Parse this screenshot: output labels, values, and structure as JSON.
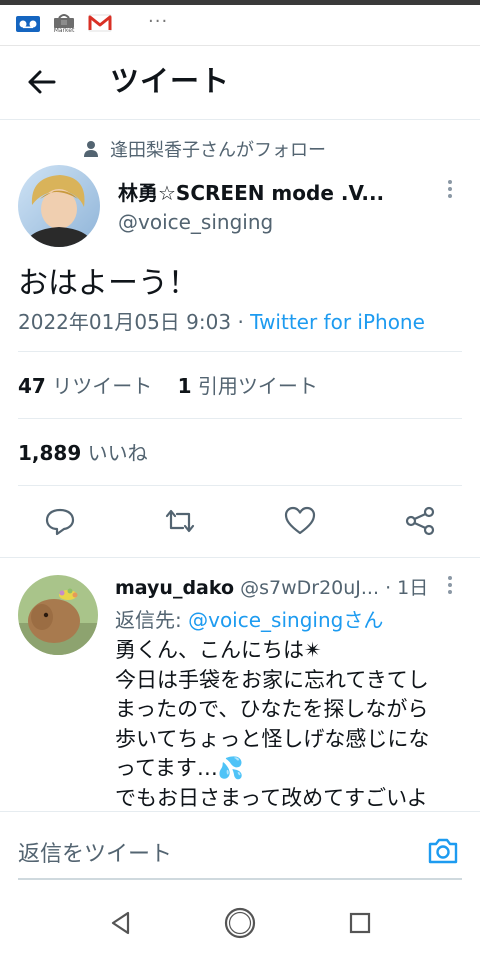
{
  "status_bar": {
    "icons": [
      "voicemail-icon",
      "market-app-icon",
      "gmail-icon"
    ],
    "market_label": "Market",
    "more_label": "···"
  },
  "header": {
    "title": "ツイート",
    "back_icon": "arrow-left-icon"
  },
  "tweet": {
    "social_context": "逢田梨香子さんがフォロー",
    "author_name": "林勇☆SCREEN mode .V...",
    "author_handle": "@voice_singing",
    "text": "おはよーう！",
    "timestamp": "2022年01月05日 9:03",
    "separator": "·",
    "source": "Twitter for iPhone",
    "retweets": {
      "count": "47",
      "label": "リツイート"
    },
    "quotes": {
      "count": "1",
      "label": "引用ツイート"
    },
    "likes": {
      "count": "1,889",
      "label": "いいね"
    },
    "actions": [
      "reply-icon",
      "retweet-icon",
      "like-icon",
      "share-icon"
    ]
  },
  "reply": {
    "name": "mayu_dako",
    "handle": "@s7wDr20uJ...",
    "separator": "·",
    "time": "1日",
    "replying_to_label": "返信先:",
    "replying_to_handle": "@voice_singingさん",
    "lines": [
      "勇くん、こんにちは✴",
      "今日は手袋をお家に忘れてきてし",
      "まったので、ひなたを探しながら",
      "歩いてちょっと怪しげな感じにな",
      "ってます…💦",
      "でもお日さまって改めてすごいよ"
    ]
  },
  "compose": {
    "placeholder": "返信をツイート",
    "camera_icon": "camera-icon"
  },
  "nav": {
    "buttons": [
      "back-triangle-icon",
      "home-circle-icon",
      "recents-square-icon"
    ]
  },
  "colors": {
    "accent": "#1d9bf0",
    "text": "#0f1419",
    "secondary": "#536471",
    "divider": "#e6ecf0"
  }
}
